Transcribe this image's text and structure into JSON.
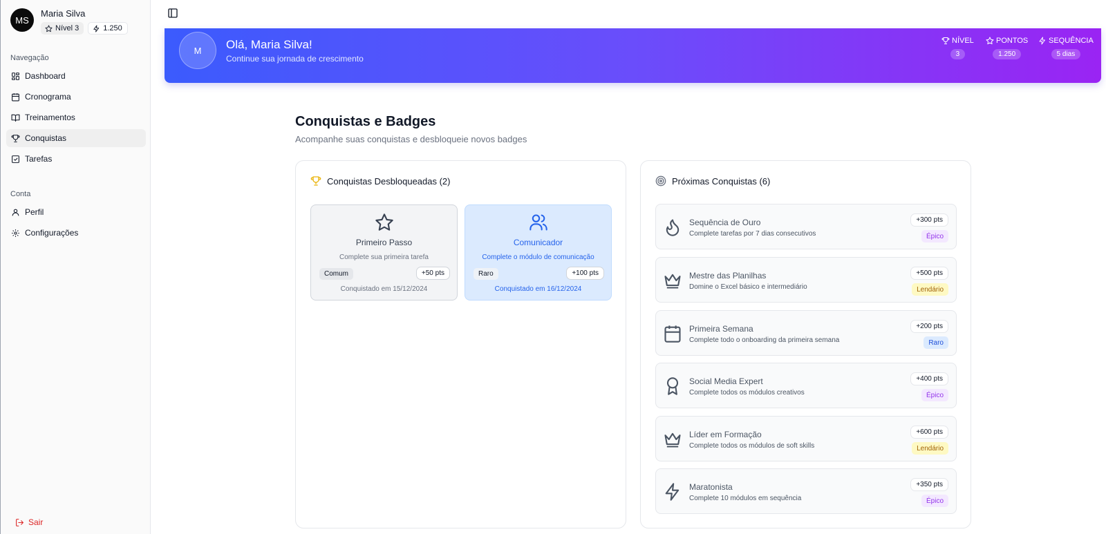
{
  "user": {
    "initials": "MS",
    "name": "Maria Silva",
    "level": "Nível 3",
    "points": "1.250"
  },
  "sidebar": {
    "nav_label": "Navegação",
    "nav_items": [
      {
        "label": "Dashboard",
        "icon": "dashboard-icon"
      },
      {
        "label": "Cronograma",
        "icon": "calendar-icon"
      },
      {
        "label": "Treinamentos",
        "icon": "book-icon"
      },
      {
        "label": "Conquistas",
        "icon": "trophy-icon",
        "active": true
      },
      {
        "label": "Tarefas",
        "icon": "checkbox-icon"
      }
    ],
    "account_label": "Conta",
    "account_items": [
      {
        "label": "Perfil",
        "icon": "user-icon"
      },
      {
        "label": "Configurações",
        "icon": "gear-icon"
      }
    ],
    "logout": "Sair"
  },
  "hero": {
    "avatar": "M",
    "greeting": "Olá, Maria Silva!",
    "subtitle": "Continue sua jornada de crescimento",
    "stats": [
      {
        "label": "NÍVEL",
        "value": "3",
        "icon": "trophy-icon"
      },
      {
        "label": "PONTOS",
        "value": "1.250",
        "icon": "star-icon"
      },
      {
        "label": "SEQUÊNCIA",
        "value": "5 dias",
        "icon": "zap-icon"
      }
    ],
    "gradient": [
      "#3b5bfd",
      "#9a24f3"
    ]
  },
  "page": {
    "title": "Conquistas e Badges",
    "subtitle": "Acompanhe suas conquistas e desbloqueie novos badges"
  },
  "unlocked": {
    "heading": "Conquistas Desbloqueadas (2)",
    "items": [
      {
        "title": "Primeiro Passo",
        "desc": "Complete sua primeira tarefa",
        "rarity": "Comum",
        "points": "+50 pts",
        "date": "Conquistado em 15/12/2024",
        "icon": "star-icon"
      },
      {
        "title": "Comunicador",
        "desc": "Complete o módulo de comunicação",
        "rarity": "Raro",
        "points": "+100 pts",
        "date": "Conquistado em 16/12/2024",
        "icon": "users-icon"
      }
    ]
  },
  "upcoming": {
    "heading": "Próximas Conquistas (6)",
    "items": [
      {
        "title": "Sequência de Ouro",
        "desc": "Complete tarefas por 7 dias consecutivos",
        "points": "+300 pts",
        "rarity": "Épico",
        "icon": "flame-icon"
      },
      {
        "title": "Mestre das Planilhas",
        "desc": "Domine o Excel básico e intermediário",
        "points": "+500 pts",
        "rarity": "Lendário",
        "icon": "crown-icon"
      },
      {
        "title": "Primeira Semana",
        "desc": "Complete todo o onboarding da primeira semana",
        "points": "+200 pts",
        "rarity": "Raro",
        "icon": "calendar-icon"
      },
      {
        "title": "Social Media Expert",
        "desc": "Complete todos os módulos creativos",
        "points": "+400 pts",
        "rarity": "Épico",
        "icon": "award-icon"
      },
      {
        "title": "Líder em Formação",
        "desc": "Complete todos os módulos de soft skills",
        "points": "+600 pts",
        "rarity": "Lendário",
        "icon": "crown-icon"
      },
      {
        "title": "Maratonista",
        "desc": "Complete 10 módulos em sequência",
        "points": "+350 pts",
        "rarity": "Épico",
        "icon": "zap-icon"
      }
    ]
  }
}
